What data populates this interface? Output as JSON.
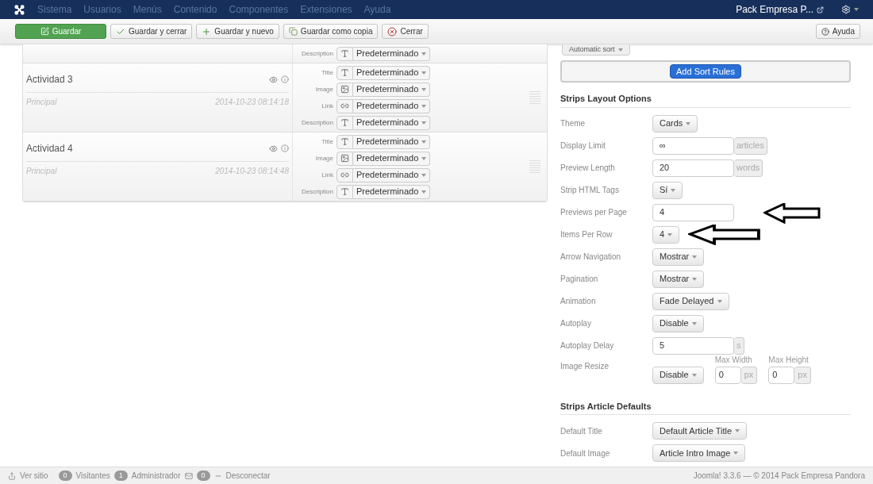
{
  "navbar": {
    "menu": [
      "Sistema",
      "Usuarios",
      "Menús",
      "Contenido",
      "Componentes",
      "Extensiones",
      "Ayuda"
    ],
    "site_link": "Pack Empresa P..."
  },
  "toolbar": {
    "buttons": [
      {
        "label": "Guardar",
        "kind": "save"
      },
      {
        "label": "Guardar y cerrar",
        "kind": "check"
      },
      {
        "label": "Guardar y nuevo",
        "kind": "new"
      },
      {
        "label": "Guardar como copia",
        "kind": "copy"
      },
      {
        "label": "Cerrar",
        "kind": "close"
      }
    ],
    "help": "Ayuda"
  },
  "items": [
    {
      "fields": [
        {
          "label": "Description",
          "kind": "text",
          "value": "Predeterminado"
        }
      ]
    },
    {
      "title": "Actividad 3",
      "category": "Principal",
      "date": "2014-10-23 08:14:18",
      "fields": [
        {
          "label": "Title",
          "kind": "text",
          "value": "Predeterminado"
        },
        {
          "label": "Image",
          "kind": "image",
          "value": "Predeterminado"
        },
        {
          "label": "Link",
          "kind": "link",
          "value": "Predeterminado"
        },
        {
          "label": "Description",
          "kind": "text",
          "value": "Predeterminado"
        }
      ]
    },
    {
      "title": "Actividad 4",
      "category": "Principal",
      "date": "2014-10-23 08:14:48",
      "fields": [
        {
          "label": "Title",
          "kind": "text",
          "value": "Predeterminado"
        },
        {
          "label": "Image",
          "kind": "image",
          "value": "Predeterminado"
        },
        {
          "label": "Link",
          "kind": "link",
          "value": "Predeterminado"
        },
        {
          "label": "Description",
          "kind": "text",
          "value": "Predeterminado"
        }
      ]
    }
  ],
  "sort": {
    "button": "Automatic sort",
    "add_button": "Add Sort Rules"
  },
  "sections": [
    {
      "title": "Strips Layout Options",
      "rows": [
        {
          "label": "Theme",
          "kind": "select",
          "value": "Cards"
        },
        {
          "label": "Display Limit",
          "kind": "input",
          "value": "∞",
          "addon": "articles"
        },
        {
          "label": "Preview Length",
          "kind": "input",
          "value": "20",
          "addon": "words"
        },
        {
          "label": "Strip HTML Tags",
          "kind": "select",
          "value": "Sí"
        },
        {
          "label": "Previews per Page",
          "kind": "input",
          "value": "4"
        },
        {
          "label": "Items Per Row",
          "kind": "select",
          "value": "4"
        },
        {
          "label": "Arrow Navigation",
          "kind": "select",
          "value": "Mostrar"
        },
        {
          "label": "Pagination",
          "kind": "select",
          "value": "Mostrar"
        },
        {
          "label": "Animation",
          "kind": "select",
          "value": "Fade Delayed"
        },
        {
          "label": "Autoplay",
          "kind": "select",
          "value": "Disable"
        },
        {
          "label": "Autoplay Delay",
          "kind": "input",
          "value": "5",
          "addon": "s"
        },
        {
          "label": "Image Resize",
          "kind": "resize",
          "value": "Disable",
          "width_label": "Max Width",
          "width_value": "0",
          "width_unit": "px",
          "height_label": "Max Height",
          "height_value": "0",
          "height_unit": "px"
        }
      ]
    },
    {
      "title": "Strips Article Defaults",
      "rows": [
        {
          "label": "Default Title",
          "kind": "select",
          "value": "Default Article Title"
        },
        {
          "label": "Default Image",
          "kind": "select",
          "value": "Article Intro Image"
        }
      ]
    }
  ],
  "status_bar": {
    "view_site": "Ver sitio",
    "visitors_count": "0",
    "visitors": "Visitantes",
    "admins_count": "1",
    "admins": "Administrador",
    "messages_count": "0",
    "logout": "Desconectar",
    "copyright": "Joomla! 3.3.6 — © 2014 Pack Empresa Pandora"
  }
}
